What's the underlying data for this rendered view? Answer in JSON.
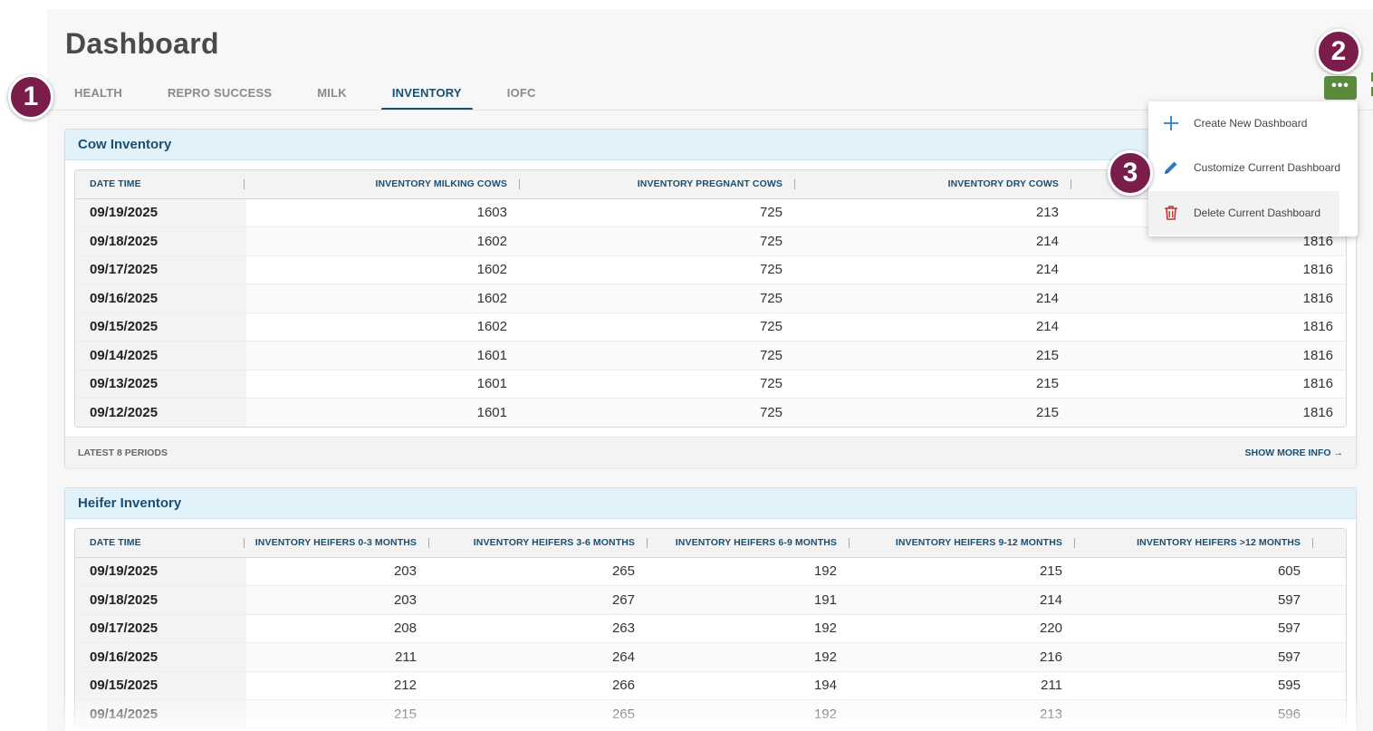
{
  "page": {
    "title": "Dashboard"
  },
  "tabs": [
    {
      "label": "HEALTH"
    },
    {
      "label": "REPRO SUCCESS"
    },
    {
      "label": "MILK"
    },
    {
      "label": "INVENTORY"
    },
    {
      "label": "IOFC"
    }
  ],
  "more_button": {
    "label": "•••"
  },
  "menu": {
    "items": [
      {
        "label": "Create New Dashboard",
        "icon": "plus-icon"
      },
      {
        "label": "Customize Current Dashboard",
        "icon": "pencil-icon"
      },
      {
        "label": "Delete Current Dashboard",
        "icon": "trash-icon"
      }
    ]
  },
  "badges": [
    "1",
    "2",
    "3"
  ],
  "cow_inventory": {
    "title": "Cow Inventory",
    "columns": [
      "DATE TIME",
      "INVENTORY MILKING COWS",
      "INVENTORY PREGNANT COWS",
      "INVENTORY DRY COWS",
      ""
    ],
    "rows": [
      [
        "09/19/2025",
        "1603",
        "725",
        "213",
        ""
      ],
      [
        "09/18/2025",
        "1602",
        "725",
        "214",
        "1816"
      ],
      [
        "09/17/2025",
        "1602",
        "725",
        "214",
        "1816"
      ],
      [
        "09/16/2025",
        "1602",
        "725",
        "214",
        "1816"
      ],
      [
        "09/15/2025",
        "1602",
        "725",
        "214",
        "1816"
      ],
      [
        "09/14/2025",
        "1601",
        "725",
        "215",
        "1816"
      ],
      [
        "09/13/2025",
        "1601",
        "725",
        "215",
        "1816"
      ],
      [
        "09/12/2025",
        "1601",
        "725",
        "215",
        "1816"
      ]
    ],
    "footer_left": "LATEST 8 PERIODS",
    "footer_right": "SHOW MORE INFO →"
  },
  "heifer_inventory": {
    "title": "Heifer Inventory",
    "columns": [
      "DATE TIME",
      "INVENTORY HEIFERS 0-3 MONTHS",
      "INVENTORY HEIFERS 3-6 MONTHS",
      "INVENTORY HEIFERS 6-9 MONTHS",
      "INVENTORY HEIFERS 9-12 MONTHS",
      "INVENTORY HEIFERS >12 MONTHS"
    ],
    "rows": [
      [
        "09/19/2025",
        "203",
        "265",
        "192",
        "215",
        "605"
      ],
      [
        "09/18/2025",
        "203",
        "267",
        "191",
        "214",
        "597"
      ],
      [
        "09/17/2025",
        "208",
        "263",
        "192",
        "220",
        "597"
      ],
      [
        "09/16/2025",
        "211",
        "264",
        "192",
        "216",
        "597"
      ],
      [
        "09/15/2025",
        "212",
        "266",
        "194",
        "211",
        "595"
      ],
      [
        "09/14/2025",
        "215",
        "265",
        "192",
        "213",
        "596"
      ]
    ]
  }
}
